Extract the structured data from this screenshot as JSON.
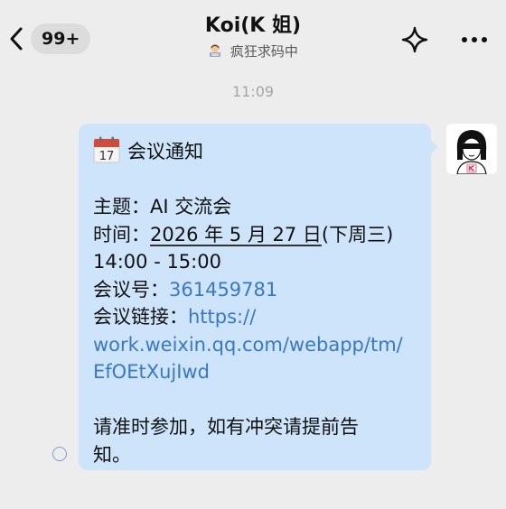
{
  "header": {
    "unread_count": "99+",
    "title": "Koi(K 姐)",
    "status_text": "疯狂求码中",
    "status_emoji": "woman-technologist-emoji"
  },
  "chat": {
    "timestamp": "11:09"
  },
  "message": {
    "heading_icon": "calendar-17-icon",
    "heading": "会议通知",
    "topic_label": "主题：",
    "topic_value": "AI 交流会",
    "time_label": "时间：",
    "date_text": "2026 年 5 月 27 日",
    "weekday_text": "(下周三)",
    "time_range": "14:00 - 15:00",
    "meeting_id_label": "会议号：",
    "meeting_id": "361459781",
    "link_label": "会议链接：",
    "link_line1": "https://",
    "link_line2": "work.weixin.qq.com/webapp/tm/",
    "link_line3": "EfOEtXujIwd",
    "closing_line1": "请准时参加，如有冲突请提前告",
    "closing_line2": "知。"
  },
  "colors": {
    "background": "#ededed",
    "bubble": "#cde4fb",
    "link": "#3a78c4"
  }
}
